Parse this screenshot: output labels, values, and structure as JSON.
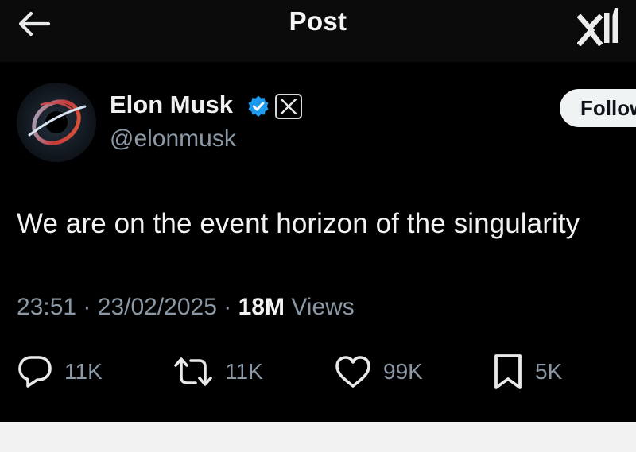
{
  "header": {
    "title": "Post",
    "back_icon": "arrow-left-icon",
    "logo_icon": "xai-logo-icon"
  },
  "author": {
    "name": "Elon Musk",
    "handle": "@elonmusk",
    "verified_icon": "verified-badge-icon",
    "affiliation_icon": "x-logo-icon",
    "avatar_icon": "black-hole-avatar"
  },
  "follow": {
    "label": "Follow"
  },
  "post": {
    "text": "We are on the event horizon of the singularity",
    "time": "23:51",
    "date": "23/02/2025",
    "separator": "·",
    "views_count": "18M",
    "views_label": "Views"
  },
  "actions": {
    "replies": "11K",
    "reposts": "11K",
    "likes": "99K",
    "bookmarks": "5K"
  },
  "colors": {
    "background": "#000000",
    "text": "#e7e9ea",
    "secondary_text": "#8b98a5",
    "verified_blue": "#1d9bf0",
    "follow_button": "#eff3f4"
  }
}
